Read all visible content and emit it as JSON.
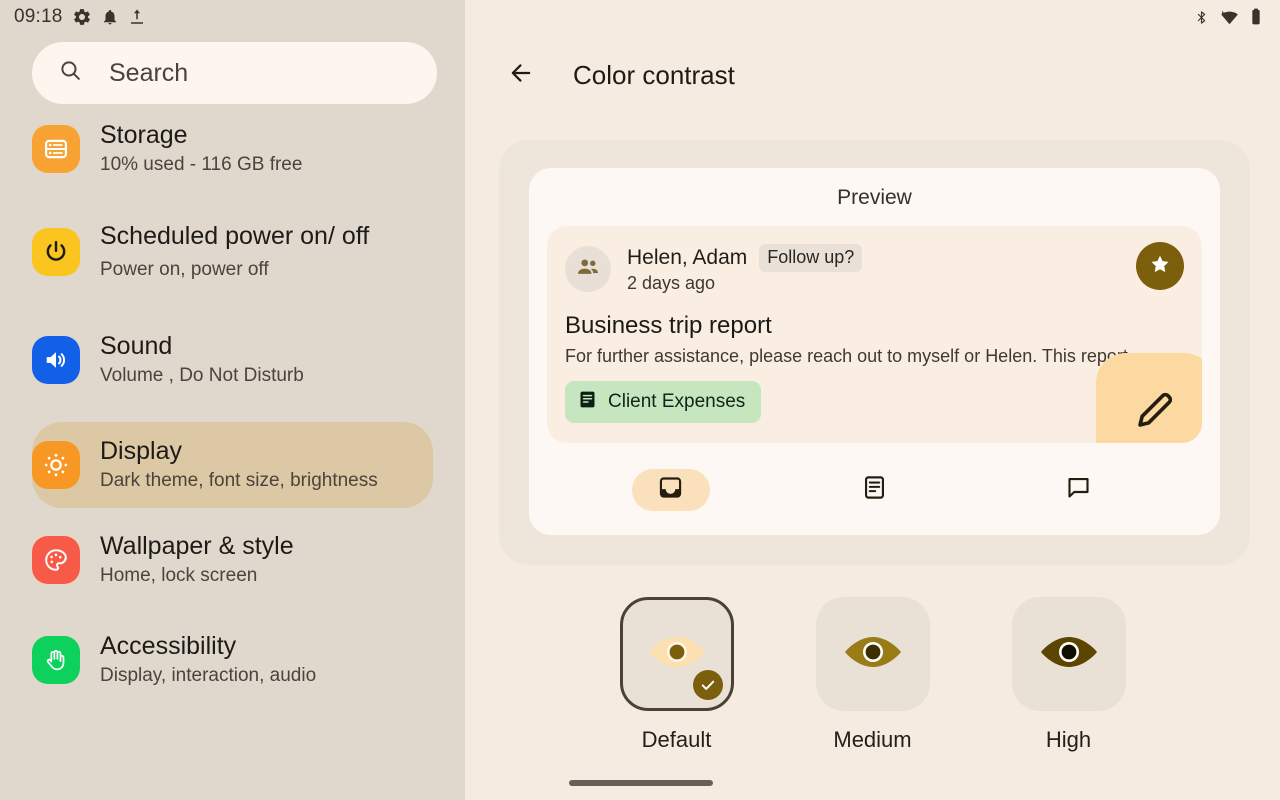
{
  "sidebar": {
    "status": {
      "time": "09:18",
      "icons": [
        "gear-icon",
        "bell-icon",
        "upload-icon"
      ]
    },
    "search": {
      "placeholder": "Search",
      "icon": "search-icon"
    },
    "items": [
      {
        "title": "Storage",
        "subtitle": "10% used - 116 GB free",
        "icon": "storage-icon",
        "icon_color": "#F7A232",
        "selected": false
      },
      {
        "title": "Scheduled power on/ off",
        "subtitle": "Power on, power off",
        "icon": "power-icon",
        "icon_color": "#FCC41F",
        "selected": false
      },
      {
        "title": "Sound",
        "subtitle": "Volume , Do Not Disturb",
        "icon": "sound-icon",
        "icon_color": "#1260E8",
        "selected": false
      },
      {
        "title": "Display",
        "subtitle": "Dark theme, font size, brightness",
        "icon": "brightness-icon",
        "icon_color": "#F79824",
        "selected": true
      },
      {
        "title": "Wallpaper & style",
        "subtitle": "Home, lock screen",
        "icon": "palette-icon",
        "icon_color": "#F85A48",
        "selected": false
      },
      {
        "title": "Accessibility",
        "subtitle": "Display, interaction, audio",
        "icon": "hand-icon",
        "icon_color": "#0CD15B",
        "selected": false
      }
    ]
  },
  "content": {
    "status_icons": [
      "bluetooth-icon",
      "wifi-icon",
      "battery-icon"
    ],
    "appbar": {
      "back_icon": "back-arrow-icon",
      "title": "Color contrast"
    },
    "preview": {
      "label": "Preview",
      "mail": {
        "avatar_icon": "people-icon",
        "sender": "Helen, Adam",
        "tag": "Follow up?",
        "time": "2 days ago",
        "star_icon": "star-icon",
        "subject": "Business trip report",
        "body": "For further assistance, please reach out to myself or Helen. This report",
        "label_chip": "Client Expenses",
        "label_chip_icon": "article-icon",
        "label_chip_color": "#C6E6C0",
        "fab_icon": "pencil-icon",
        "fab_color": "#FBD9A1"
      },
      "nav": [
        {
          "icon": "inbox-icon",
          "active": true
        },
        {
          "icon": "article-icon",
          "active": false
        },
        {
          "icon": "chat-icon",
          "active": false
        }
      ]
    },
    "contrast_options": [
      {
        "name": "Default",
        "icon": "eye-icon",
        "selected": true,
        "eye_color": "#FCE0AF",
        "pupil_color": "#7C5F0C",
        "ring_color": "#FFF6E6"
      },
      {
        "name": "Medium",
        "icon": "eye-icon",
        "selected": false,
        "eye_color": "#9A7C16",
        "pupil_color": "#3D2E00",
        "ring_color": "#FFFFFF"
      },
      {
        "name": "High",
        "icon": "eye-icon",
        "selected": false,
        "eye_color": "#5C4500",
        "pupil_color": "#120D00",
        "ring_color": "#FFFFFF"
      }
    ],
    "gesture_bar": "home-gesture-bar"
  },
  "colors": {
    "sidebar_bg": "#E0D8CC",
    "content_bg": "#F5EBE0",
    "selected_row": "#DCC8A4",
    "accent_brown": "#7C5F0C"
  }
}
